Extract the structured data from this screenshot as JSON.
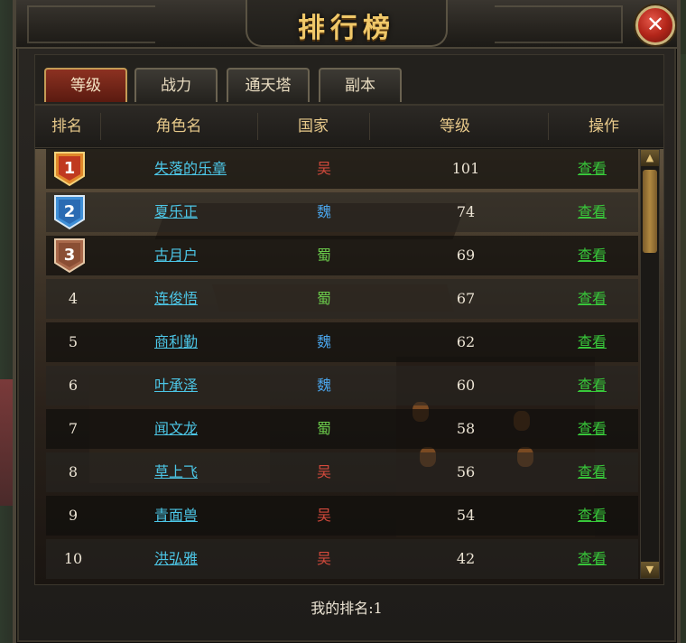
{
  "window": {
    "title": "排行榜",
    "close_label": "✕"
  },
  "tabs": [
    {
      "label": "等级",
      "active": true
    },
    {
      "label": "战力",
      "active": false
    },
    {
      "label": "通天塔",
      "active": false
    },
    {
      "label": "副本",
      "active": false
    }
  ],
  "table": {
    "headers": {
      "rank": "排名",
      "name": "角色名",
      "country": "国家",
      "level": "等级",
      "op": "操作"
    },
    "rows": [
      {
        "rank": "1",
        "name": "失落的乐章",
        "country": "吴",
        "level": "101",
        "op": "查看"
      },
      {
        "rank": "2",
        "name": "夏乐正",
        "country": "魏",
        "level": "74",
        "op": "查看"
      },
      {
        "rank": "3",
        "name": "古月户",
        "country": "蜀",
        "level": "69",
        "op": "查看"
      },
      {
        "rank": "4",
        "name": "连俊悟",
        "country": "蜀",
        "level": "67",
        "op": "查看"
      },
      {
        "rank": "5",
        "name": "商利勤",
        "country": "魏",
        "level": "62",
        "op": "查看"
      },
      {
        "rank": "6",
        "name": "叶承泽",
        "country": "魏",
        "level": "60",
        "op": "查看"
      },
      {
        "rank": "7",
        "name": "闻文龙",
        "country": "蜀",
        "level": "58",
        "op": "查看"
      },
      {
        "rank": "8",
        "name": "草上飞",
        "country": "吴",
        "level": "56",
        "op": "查看"
      },
      {
        "rank": "9",
        "name": "青面兽",
        "country": "吴",
        "level": "54",
        "op": "查看"
      },
      {
        "rank": "10",
        "name": "洪弘雅",
        "country": "吴",
        "level": "42",
        "op": "查看"
      }
    ]
  },
  "footer": {
    "my_rank": "我的排名:1"
  },
  "colors": {
    "gold_medal": "#e0882a",
    "silver_medal": "#3f8fd6",
    "bronze_medal": "#a8684a",
    "wu": "#d44a3c",
    "wei": "#4aa3e8",
    "shu": "#6ac84a",
    "link": "#4cc6e6",
    "op_link": "#38c83a"
  },
  "icons": {
    "scroll_up": "▲",
    "scroll_down": "▼"
  }
}
